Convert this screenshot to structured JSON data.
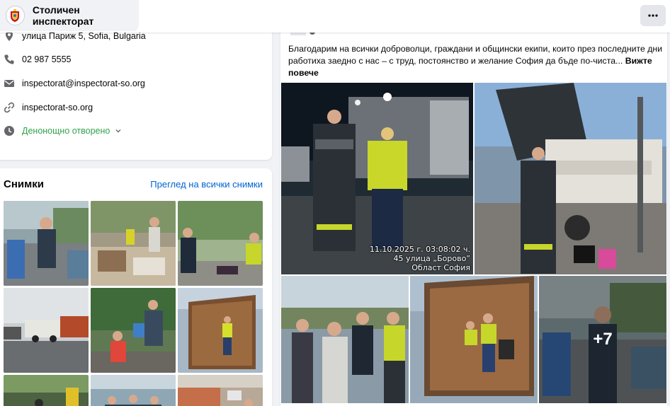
{
  "header": {
    "page_name": "Столичен инспекторат",
    "more_icon": "more-horizontal-icon"
  },
  "intro": {
    "address": "улица Париж 5, Sofia, Bulgaria",
    "phone": "02 987 5555",
    "email": "inspectorat@inspectorat-so.org",
    "website": "inspectorat-so.org",
    "hours": "Денонощно отворено",
    "icons": [
      "location-icon",
      "phone-icon",
      "email-icon",
      "link-icon",
      "clock-icon"
    ],
    "hours_color": "#31a24c"
  },
  "photos": {
    "title": "Снимки",
    "see_all": "Преглед на всички снимки",
    "link_color": "#0064d1"
  },
  "post": {
    "text": "Благодарим на всички доброволци, граждани и общински екипи, които през последните дни работиха заедно с нас – с труд, постоянство и желание София да бъде по-чиста...",
    "see_more": "Вижте повече",
    "stamp_line1": "11.10.2025 г. 03:08:02 ч.",
    "stamp_line2": "45 улица „Борово”",
    "stamp_line3": "Област София",
    "more_count": "+7"
  }
}
